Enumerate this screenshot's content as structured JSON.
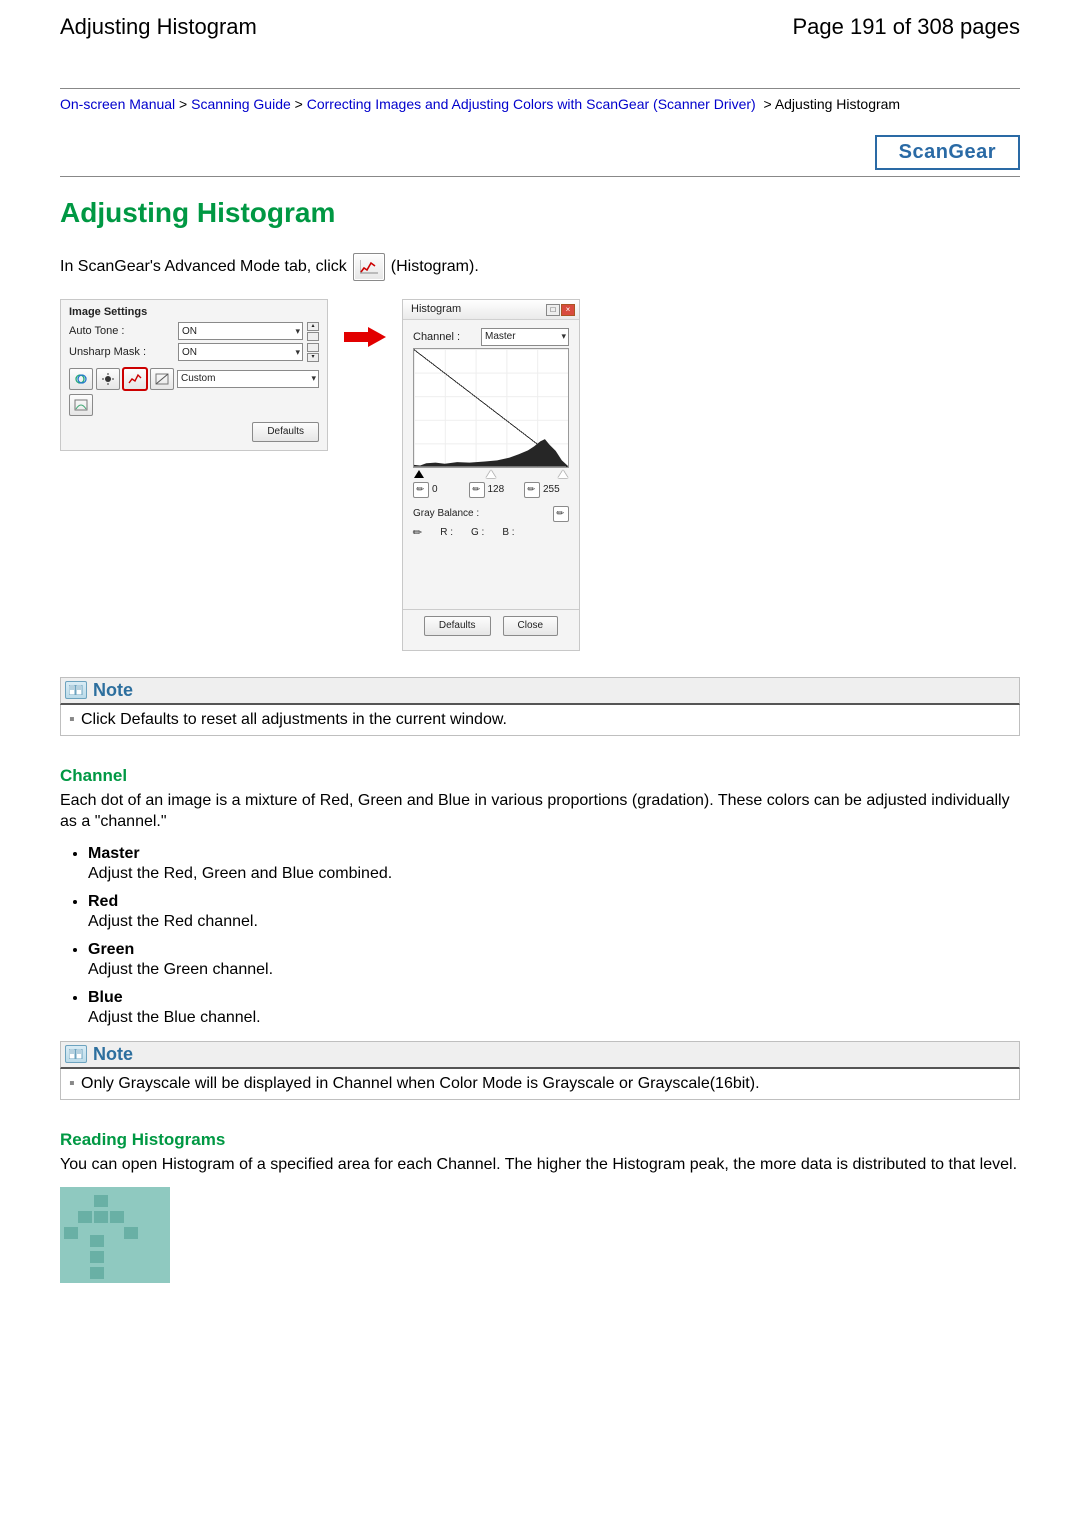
{
  "header": {
    "title": "Adjusting Histogram",
    "page_counter": "Page 191 of 308 pages"
  },
  "breadcrumb": {
    "links": [
      "On-screen Manual",
      "Scanning Guide",
      "Correcting Images and Adjusting Colors with ScanGear (Scanner Driver)"
    ],
    "current": "Adjusting Histogram",
    "sep": " > "
  },
  "brand": "ScanGear",
  "page_title": "Adjusting Histogram",
  "intro": {
    "pre": "In ScanGear's Advanced Mode tab, click ",
    "post": " (Histogram)."
  },
  "image_settings": {
    "title": "Image Settings",
    "auto_tone_label": "Auto Tone :",
    "auto_tone_value": "ON",
    "unsharp_label": "Unsharp Mask :",
    "unsharp_value": "ON",
    "custom_value": "Custom",
    "defaults": "Defaults"
  },
  "hist_dialog": {
    "title": "Histogram",
    "channel_label": "Channel :",
    "channel_value": "Master",
    "vals": {
      "low": "0",
      "mid": "128",
      "high": "255"
    },
    "gray_balance": "Gray Balance :",
    "r": "R :",
    "g": "G :",
    "b": "B :",
    "defaults": "Defaults",
    "close": "Close"
  },
  "notes": {
    "label": "Note",
    "note1": "Click Defaults to reset all adjustments in the current window.",
    "note2": "Only Grayscale will be displayed in Channel when Color Mode is Grayscale or Grayscale(16bit)."
  },
  "channel": {
    "heading": "Channel",
    "intro": "Each dot of an image is a mixture of Red, Green and Blue in various proportions (gradation). These colors can be adjusted individually as a \"channel.\"",
    "items": [
      {
        "title": "Master",
        "desc": "Adjust the Red, Green and Blue combined."
      },
      {
        "title": "Red",
        "desc": "Adjust the Red channel."
      },
      {
        "title": "Green",
        "desc": "Adjust the Green channel."
      },
      {
        "title": "Blue",
        "desc": "Adjust the Blue channel."
      }
    ]
  },
  "reading": {
    "heading": "Reading Histograms",
    "intro": "You can open Histogram of a specified area for each Channel. The higher the Histogram peak, the more data is distributed to that level."
  }
}
